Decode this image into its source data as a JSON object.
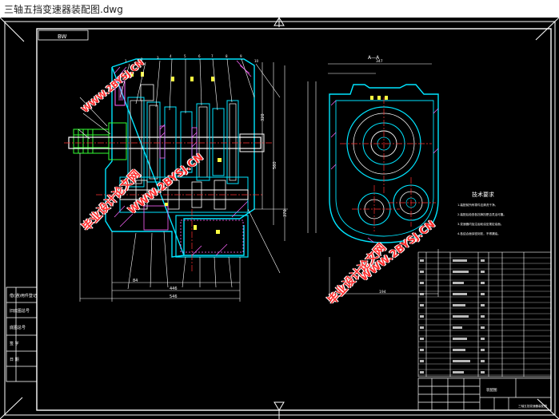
{
  "window": {
    "title": "三轴五挡变速器装配图.dwg"
  },
  "drawing": {
    "view_label_left": "BW",
    "section_label": "A—A",
    "tech_title": "技术要求",
    "tech_lines": [
      "1.装配前所有零件应清洗干净。",
      "2.装配后检查各挡换挡是否灵活可靠。",
      "3.变速器内加注齿轮油至规定油面。",
      "4.各结合面涂密封胶，不得漏油。"
    ],
    "left_table_labels": [
      "借(通)用件登记",
      "旧底图总号",
      "底图总号",
      "签 字",
      "日 期"
    ],
    "title_block_name": "三轴五挡变速器装配图",
    "title_block_short": "装配图",
    "dims": [
      "546",
      "446",
      "194",
      "84",
      "130",
      "320",
      "560",
      "370",
      "347"
    ]
  },
  "watermarks": [
    {
      "text": "毕业设计论文网"
    },
    {
      "text": "WWW.2BYSJ.CN"
    },
    {
      "text": "毕业设计论文网"
    },
    {
      "text": "WWW.2BYSJ.CN"
    },
    {
      "text": "WWW.2BYSJ.CN"
    },
    {
      "text": "毕业设计论文网"
    }
  ],
  "colors": {
    "frame": "#ffffff",
    "outline": "#00e5ff",
    "center": "#ff3030",
    "hatch": "#ff66ff",
    "gear": "#33ff33",
    "dim": "#ffff40",
    "watermark": "#ff2d2d"
  }
}
